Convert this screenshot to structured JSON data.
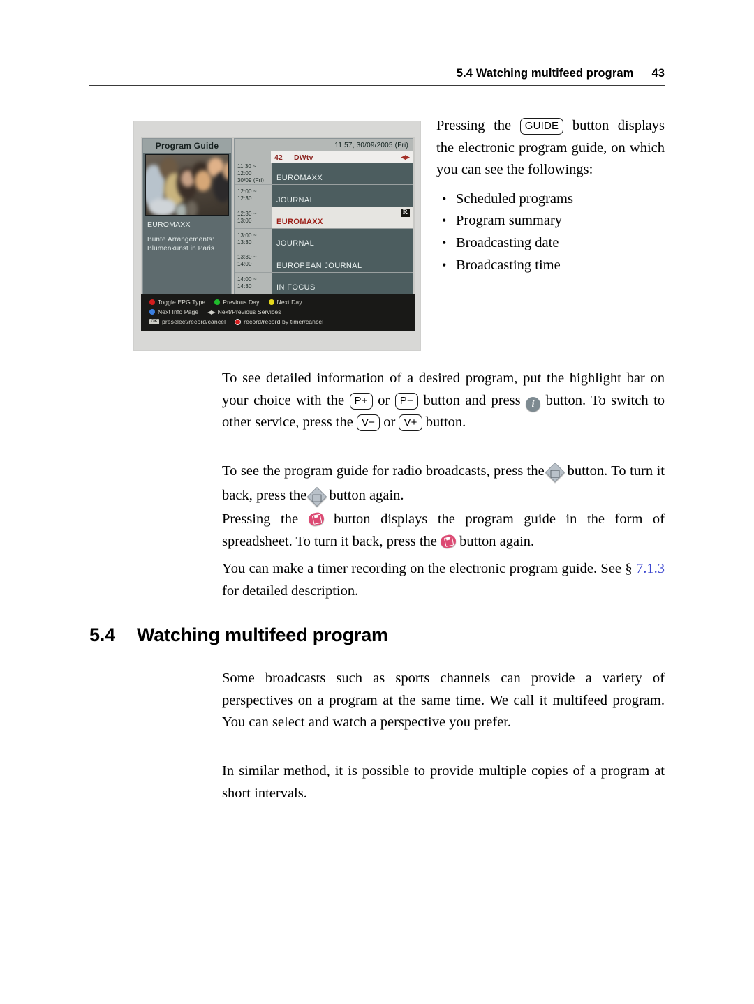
{
  "header": {
    "title": "5.4 Watching multifeed program",
    "page_number": "43"
  },
  "figure": {
    "epg": {
      "panel_title": "Program Guide",
      "selected_channel_name": "EUROMAXX",
      "selected_program_description": "Bunte Arrangements:\nBlumenkunst in Paris",
      "datetime": "11:57, 30/09/2005 (Fri)",
      "channel_number": "42",
      "channel_name": "DWtv",
      "channel_arrows": "◀▶",
      "rows": [
        {
          "time": "11:30 ~ 12:00",
          "date": "30/09 (Fri)",
          "title": "EUROMAXX",
          "selected": false,
          "badge": ""
        },
        {
          "time": "12:00 ~ 12:30",
          "date": "",
          "title": "JOURNAL",
          "selected": false,
          "badge": ""
        },
        {
          "time": "12:30 ~ 13:00",
          "date": "",
          "title": "EUROMAXX",
          "selected": true,
          "badge": "R"
        },
        {
          "time": "13:00 ~ 13:30",
          "date": "",
          "title": "JOURNAL",
          "selected": false,
          "badge": ""
        },
        {
          "time": "13:30 ~ 14:00",
          "date": "",
          "title": "EUROPEAN JOURNAL",
          "selected": false,
          "badge": ""
        },
        {
          "time": "14:00 ~ 14:30",
          "date": "",
          "title": "IN FOCUS",
          "selected": false,
          "badge": ""
        }
      ],
      "legend": {
        "line1": [
          {
            "color": "#d21d1d",
            "label": "Toggle EPG Type"
          },
          {
            "color": "#1fbb2c",
            "label": "Previous Day"
          },
          {
            "color": "#e5d81c",
            "label": "Next Day"
          }
        ],
        "line2_dot_label": "Next Info Page",
        "line2_arrows": "◀▶",
        "line2_arrows_label": "Next/Previous Services",
        "line3_ok": "OK",
        "line3_ok_label": "preselect/record/cancel",
        "line3_rec_label": "record/record by timer/cancel"
      }
    }
  },
  "intro": {
    "para_1a": "Pressing the",
    "guide_key": "GUIDE",
    "para_1b": "button displays the electronic program guide, on which you can see the followings:",
    "bullets": [
      "Scheduled programs",
      "Program summary",
      "Broadcasting date",
      "Broadcasting time"
    ]
  },
  "body": {
    "p1_a": "To see detailed information of a desired program, put the highlight bar on your choice with the",
    "p1_key_pplus": "P+",
    "p1_or1": "or",
    "p1_key_pminus": "P−",
    "p1_b": "button and press",
    "p1_c": "button.  To switch to other service, press the",
    "p1_key_vminus": "V−",
    "p1_or2": "or",
    "p1_key_vplus": "V+",
    "p1_d": "button.",
    "p2_a": "To see the program guide for radio broadcasts, press the",
    "p2_b": "button. To turn it back, press the",
    "p2_c": "button again.",
    "p3_a": "Pressing the",
    "p3_b": "button displays the program guide in the form of spreadsheet. To turn it back, press the",
    "p3_c": "button again.",
    "p4_a": "You can make a timer recording on the electronic program guide. See §",
    "p4_link": "7.1.3",
    "p4_b": "for detailed description."
  },
  "section": {
    "number": "5.4",
    "title": "Watching multifeed program",
    "p1": "Some broadcasts such as sports channels can provide a variety of perspectives on a program at the same time. We call it multifeed program.  You can select and watch a perspective you prefer.",
    "p2": "In similar method, it is possible to provide multiple copies of a program at short intervals."
  },
  "icons": {
    "info": "i",
    "tv_radio": "tv-radio-toggle-icon",
    "spreadsheet": "spreadsheet-icon"
  }
}
